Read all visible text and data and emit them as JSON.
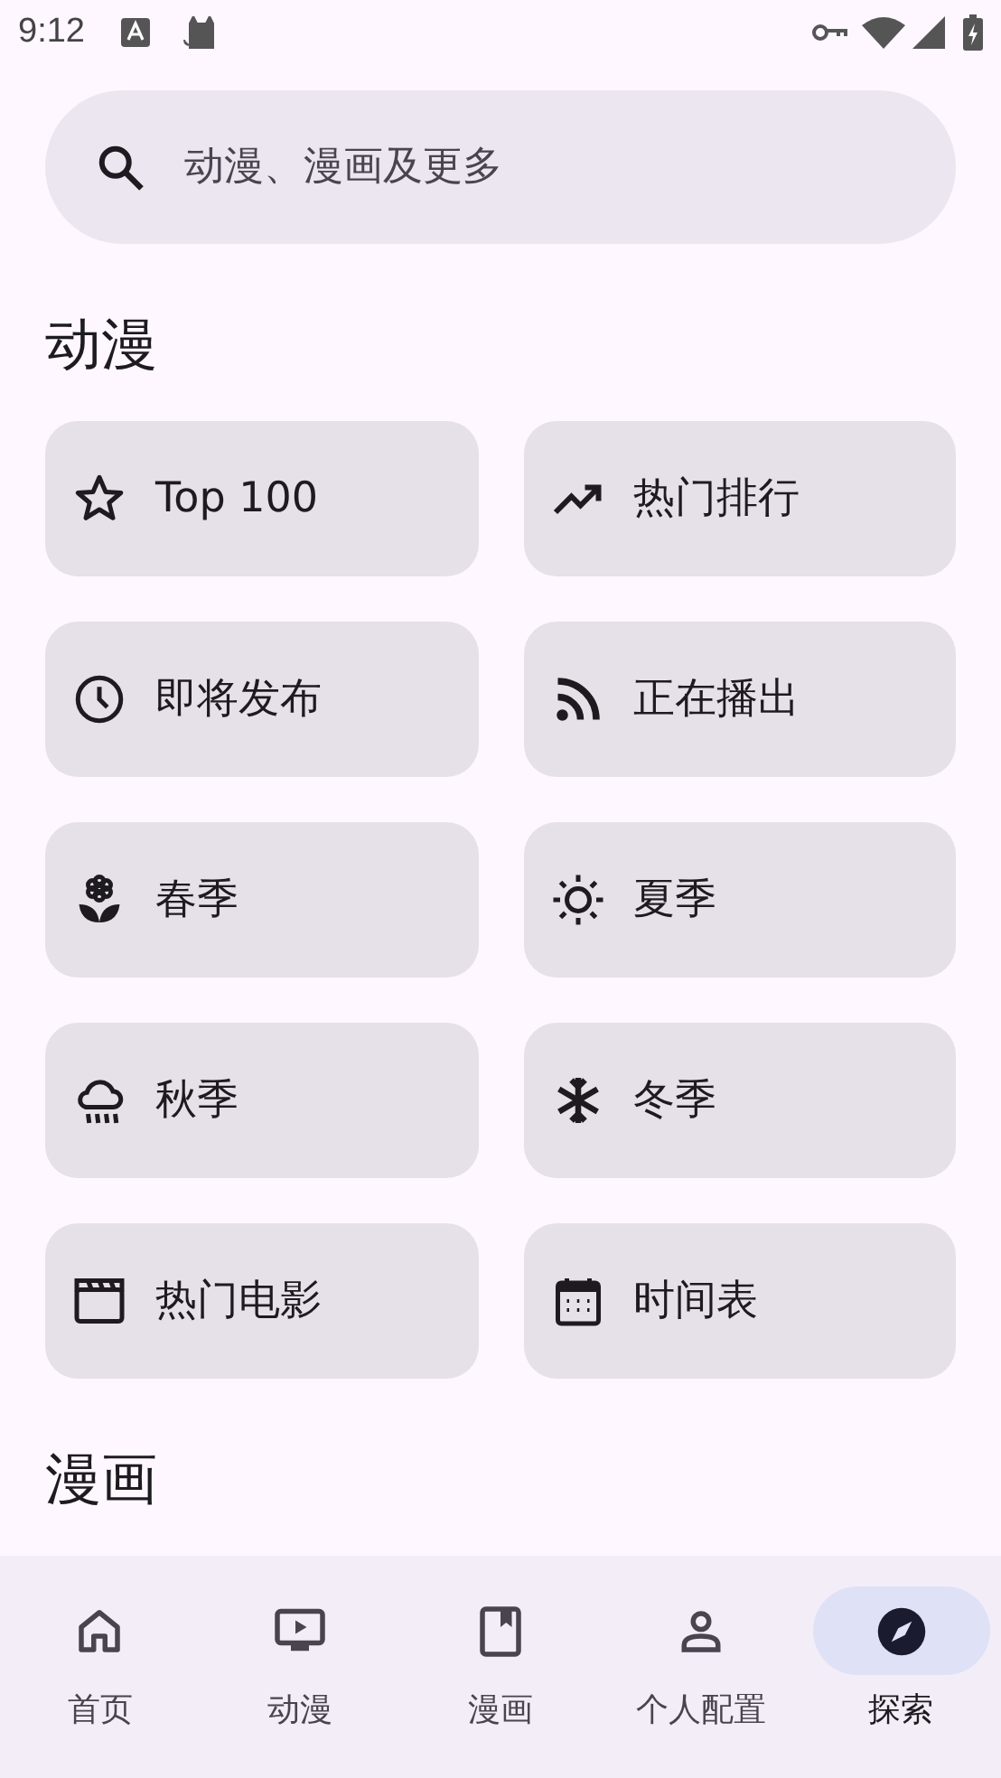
{
  "status_bar": {
    "time": "9:12"
  },
  "search": {
    "placeholder": "动漫、漫画及更多"
  },
  "sections": [
    {
      "title": "动漫",
      "items": [
        {
          "label": "Top 100"
        },
        {
          "label": "热门排行"
        },
        {
          "label": "即将发布"
        },
        {
          "label": "正在播出"
        },
        {
          "label": "春季"
        },
        {
          "label": "夏季"
        },
        {
          "label": "秋季"
        },
        {
          "label": "冬季"
        },
        {
          "label": "热门电影"
        },
        {
          "label": "时间表"
        }
      ]
    },
    {
      "title": "漫画"
    }
  ],
  "bottom_nav": [
    {
      "label": "首页",
      "selected": false
    },
    {
      "label": "动漫",
      "selected": false
    },
    {
      "label": "漫画",
      "selected": false
    },
    {
      "label": "个人配置",
      "selected": false
    },
    {
      "label": "探索",
      "selected": true
    }
  ]
}
